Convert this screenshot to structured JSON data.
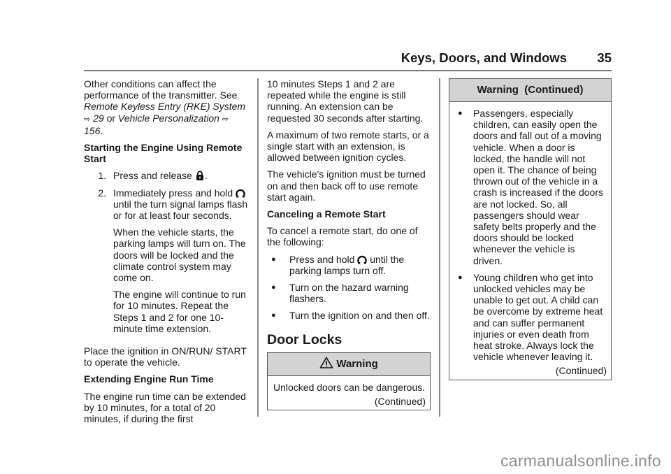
{
  "header": {
    "title": "Keys, Doors, and Windows",
    "page_number": "35"
  },
  "column1": {
    "intro": {
      "text_a": "Other conditions can affect the performance of the transmitter. See ",
      "link1": "Remote Keyless Entry (RKE) System",
      "ref_arrow": "⇨",
      "ref1": "29",
      "or": " or ",
      "link2": "Vehicle Personalization",
      "ref2": "156",
      "end": "."
    },
    "heading": "Starting the Engine Using Remote Start",
    "steps": [
      {
        "num": "1.",
        "text": "Press and release",
        "icon": "lock-icon",
        "after": "."
      },
      {
        "num": "2.",
        "text": "Immediately press and hold",
        "icon": "remote-start-icon",
        "after": "until the turn signal lamps flash or for at least four seconds.",
        "paras": [
          "When the vehicle starts, the parking lamps will turn on. The doors will be locked and the climate control system may come on.",
          "The engine will continue to run for 10 minutes. Repeat the Steps 1 and 2 for one 10-minute time extension."
        ]
      }
    ],
    "para_ignition": "Place the ignition in ON/RUN/ START to operate the vehicle.",
    "heading2": "Extending Engine Run Time",
    "para_extend": "The engine run time can be extended by 10 minutes, for a total of 20 minutes, if during the first"
  },
  "column2": {
    "paras": [
      "10 minutes Steps 1 and 2 are repeated while the engine is still running. An extension can be requested 30 seconds after starting.",
      "A maximum of two remote starts, or a single start with an extension, is allowed between ignition cycles.",
      "The vehicle's ignition must be turned on and then back off to use remote start again."
    ],
    "heading": "Canceling a Remote Start",
    "cancel_intro": "To cancel a remote start, do one of the following:",
    "bullets": [
      {
        "before": "Press and hold",
        "icon": "remote-start-icon",
        "after": "until the parking lamps turn off."
      },
      {
        "text": "Turn on the hazard warning flashers."
      },
      {
        "text": "Turn the ignition on and then off."
      }
    ],
    "section_title": "Door Locks",
    "warning": {
      "title": "Warning",
      "icon": "warning-triangle-icon",
      "body": "Unlocked doors can be dangerous.",
      "continued": "(Continued)"
    }
  },
  "column3": {
    "warning": {
      "title": "Warning  (Continued)",
      "bullets": [
        "Passengers, especially children, can easily open the doors and fall out of a moving vehicle. When a door is locked, the handle will not open it. The chance of being thrown out of the vehicle in a crash is increased if the doors are not locked. So, all passengers should wear safety belts properly and the doors should be locked whenever the vehicle is driven.",
        "Young children who get into unlocked vehicles may be unable to get out. A child can be overcome by extreme heat and can suffer permanent injuries or even death from heat stroke. Always lock the vehicle whenever leaving it."
      ],
      "continued": "(Continued)"
    }
  },
  "bullet_glyph": "●",
  "watermark": "carmanualsonline.info"
}
